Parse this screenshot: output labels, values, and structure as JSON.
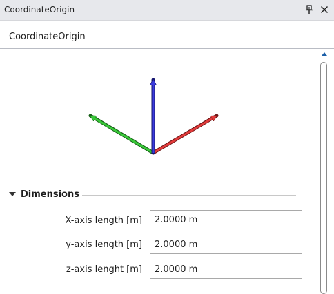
{
  "window": {
    "title": "CoordinateOrigin"
  },
  "object": {
    "name": "CoordinateOrigin"
  },
  "axes_preview": {
    "x_axis_color": "#e23b3b",
    "y_axis_color": "#39c839",
    "z_axis_color": "#3b3bde"
  },
  "section": {
    "title": "Dimensions"
  },
  "properties": [
    {
      "label": "X-axis length [m]",
      "value": "2.0000 m"
    },
    {
      "label": "y-axis length [m]",
      "value": "2.0000 m"
    },
    {
      "label": "z-axis lenght [m]",
      "value": "2.0000 m"
    }
  ]
}
